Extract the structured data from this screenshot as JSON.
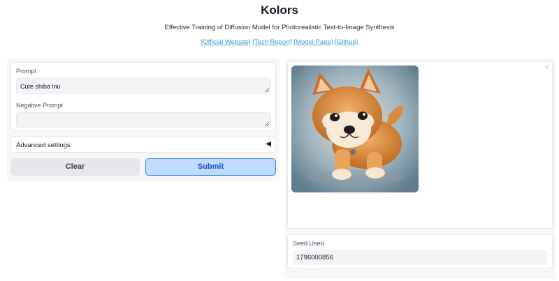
{
  "header": {
    "title": "Kolors",
    "subtitle": "Effective Training of Diffusion Model for Photorealistic Text-to-Image Synthesis",
    "links": [
      "[Official Website]",
      "[Tech Report]",
      "[Model Page]",
      "[Github]"
    ]
  },
  "prompt": {
    "label": "Prompt",
    "value": "Cute shiba inu"
  },
  "negative_prompt": {
    "label": "Negative Prompt",
    "value": ""
  },
  "advanced": {
    "label": "Advanced settings",
    "arrow": "◀"
  },
  "buttons": {
    "clear": "Clear",
    "submit": "Submit"
  },
  "output": {
    "image_label_icon": "<",
    "image_subject": "shiba-inu-puppy-painting"
  },
  "seed": {
    "label": "Seed Used",
    "value": "1796000856"
  },
  "colors": {
    "accent": "#3b82f6",
    "submit_bg": "#bfdbfe",
    "link": "#3b9bd4"
  }
}
